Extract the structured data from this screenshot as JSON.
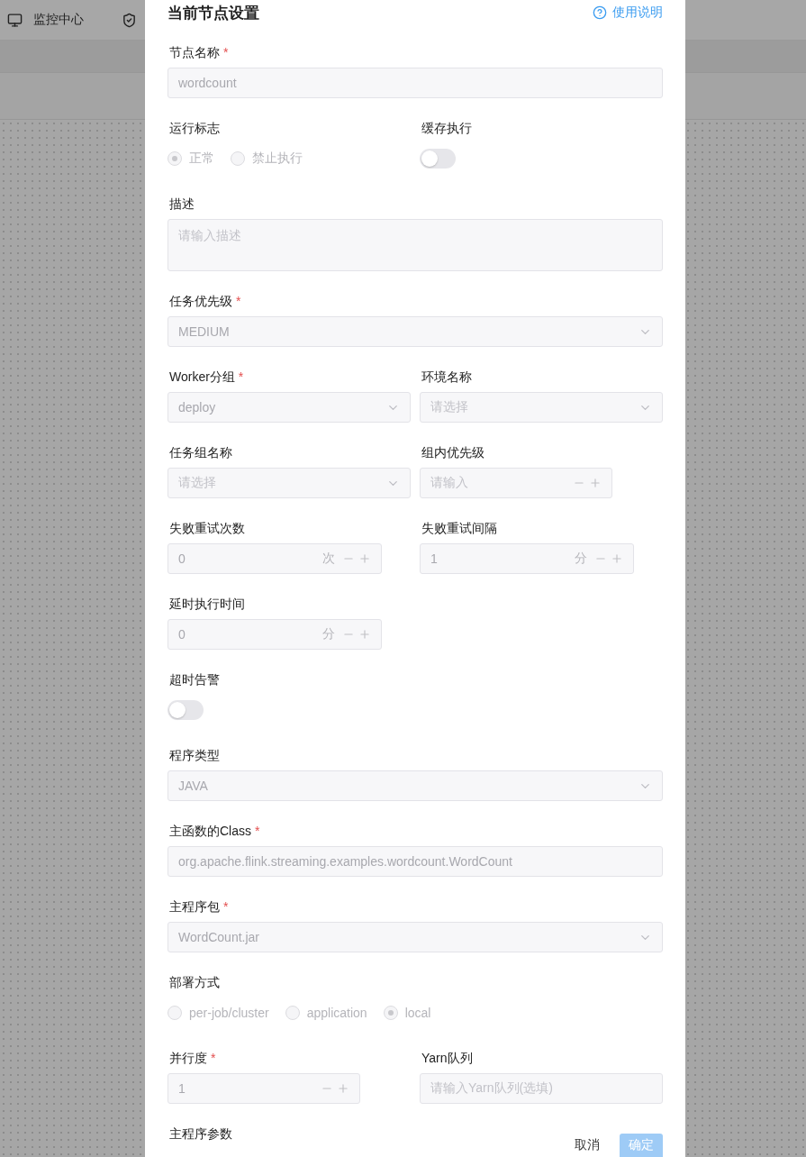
{
  "app_header": {
    "nav_label": "监控中心"
  },
  "drawer": {
    "title": "当前节点设置",
    "help_link": "使用说明",
    "rows": [
      [
        {
          "label": "节点名称",
          "required_mark": "*",
          "kind": "input",
          "value": "wordcount"
        }
      ],
      [
        {
          "label": "运行标志",
          "kind": "radio",
          "options": [
            {
              "label": "正常",
              "selected": true
            },
            {
              "label": "禁止执行",
              "selected": false
            }
          ]
        },
        {
          "label": "缓存执行",
          "kind": "switch",
          "on": false
        }
      ],
      [
        {
          "label": "描述",
          "kind": "textarea",
          "placeholder": "请输入描述"
        }
      ],
      [
        {
          "label": "任务优先级",
          "required_mark": "*",
          "kind": "select",
          "value": "MEDIUM"
        }
      ],
      [
        {
          "label": "Worker分组",
          "required_mark": "*",
          "kind": "select",
          "value": "deploy"
        },
        {
          "label": "环境名称",
          "kind": "select",
          "placeholder": "请选择"
        }
      ],
      [
        {
          "label": "任务组名称",
          "kind": "select",
          "placeholder": "请选择"
        },
        {
          "label": "组内优先级",
          "kind": "number",
          "placeholder": "请输入"
        }
      ],
      [
        {
          "label": "失败重试次数",
          "kind": "number",
          "value": "0",
          "suffix": "次"
        },
        {
          "label": "失败重试间隔",
          "kind": "number",
          "value": "1",
          "suffix": "分"
        }
      ],
      [
        {
          "label": "延时执行时间",
          "kind": "number",
          "value": "0",
          "suffix": "分"
        }
      ],
      [
        {
          "label": "超时告警",
          "kind": "switch",
          "on": false
        }
      ],
      [
        {
          "label": "程序类型",
          "kind": "select",
          "value": "JAVA"
        }
      ],
      [
        {
          "label": "主函数的Class",
          "required_mark": "*",
          "kind": "input",
          "value": "org.apache.flink.streaming.examples.wordcount.WordCount"
        }
      ],
      [
        {
          "label": "主程序包",
          "required_mark": "*",
          "kind": "select",
          "value": "WordCount.jar"
        }
      ],
      [
        {
          "label": "部署方式",
          "kind": "radio",
          "options": [
            {
              "label": "per-job/cluster",
              "selected": false
            },
            {
              "label": "application",
              "selected": false
            },
            {
              "label": "local",
              "selected": true
            }
          ]
        }
      ],
      [
        {
          "label": "并行度",
          "required_mark": "*",
          "kind": "number",
          "value": "1"
        },
        {
          "label": "Yarn队列",
          "kind": "input",
          "placeholder": "请输入Yarn队列(选填)"
        }
      ],
      [
        {
          "label": "主程序参数",
          "kind": "label_only"
        }
      ]
    ],
    "footer": {
      "cancel": "取消",
      "confirm": "确定"
    }
  }
}
